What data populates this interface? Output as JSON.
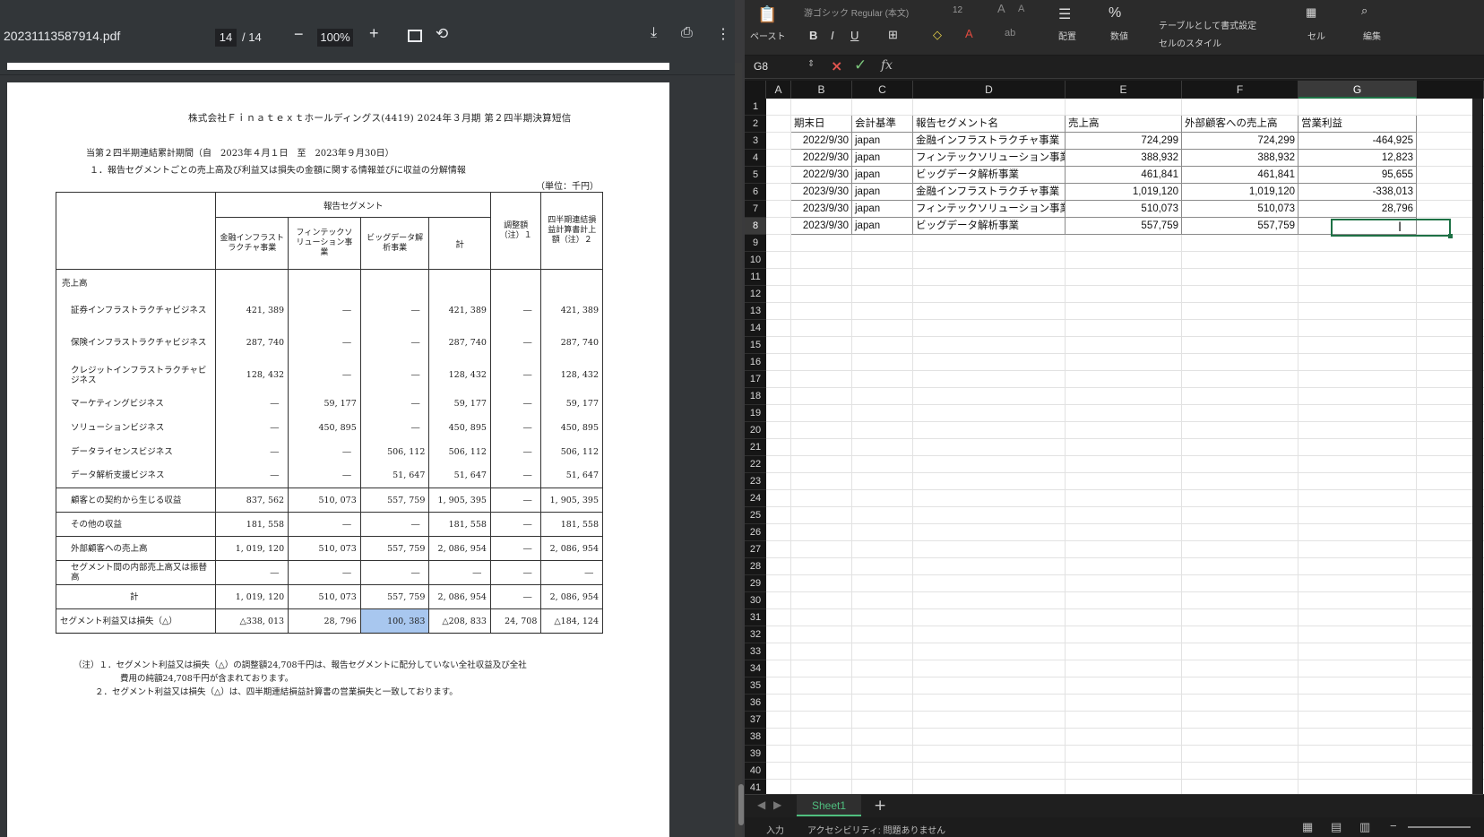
{
  "pdf": {
    "filename": "20231113587914.pdf",
    "page_current": "14",
    "page_total": "/ 14",
    "zoom": "100%",
    "header": "株式会社Ｆｉｎａｔｅｘｔホールディングス(4419) 2024年３月期 第２四半期決算短信",
    "period": "当第２四半期連結累計期間（自　2023年４月１日　至　2023年９月30日）",
    "section": "１．報告セグメントごとの売上高及び利益又は損失の金額に関する情報並びに収益の分解情報",
    "unit": "（単位：千円）",
    "table": {
      "group_header": "報告セグメント",
      "col_headers": [
        "金融インフラストラクチャ事業",
        "フィンテックソリューション事業",
        "ビッグデータ解析事業",
        "計",
        "調整額（注）１",
        "四半期連結損益計算書計上額（注）２"
      ],
      "revenue_label": "売上高",
      "rows": [
        {
          "label": "証券インフラストラクチャビジネス",
          "values": [
            "421, 389",
            "―",
            "―",
            "421, 389",
            "―",
            "421, 389"
          ]
        },
        {
          "label": "保険インフラストラクチャビジネス",
          "values": [
            "287, 740",
            "―",
            "―",
            "287, 740",
            "―",
            "287, 740"
          ]
        },
        {
          "label": "クレジットインフラストラクチャビジネス",
          "values": [
            "128, 432",
            "―",
            "―",
            "128, 432",
            "―",
            "128, 432"
          ]
        },
        {
          "label": "マーケティングビジネス",
          "values": [
            "―",
            "59, 177",
            "―",
            "59, 177",
            "―",
            "59, 177"
          ]
        },
        {
          "label": "ソリューションビジネス",
          "values": [
            "―",
            "450, 895",
            "―",
            "450, 895",
            "―",
            "450, 895"
          ]
        },
        {
          "label": "データライセンスビジネス",
          "values": [
            "―",
            "―",
            "506, 112",
            "506, 112",
            "―",
            "506, 112"
          ]
        },
        {
          "label": "データ解析支援ビジネス",
          "values": [
            "―",
            "―",
            "51, 647",
            "51, 647",
            "―",
            "51, 647"
          ]
        },
        {
          "label": "顧客との契約から生じる収益",
          "values": [
            "837, 562",
            "510, 073",
            "557, 759",
            "1, 905, 395",
            "―",
            "1, 905, 395"
          ]
        },
        {
          "label": "その他の収益",
          "values": [
            "181, 558",
            "―",
            "―",
            "181, 558",
            "―",
            "181, 558"
          ]
        },
        {
          "label": "外部顧客への売上高",
          "values": [
            "1, 019, 120",
            "510, 073",
            "557, 759",
            "2, 086, 954",
            "―",
            "2, 086, 954"
          ]
        },
        {
          "label": "セグメント間の内部売上高又は振替高",
          "values": [
            "―",
            "―",
            "―",
            "―",
            "―",
            "―"
          ]
        },
        {
          "label": "計",
          "values": [
            "1, 019, 120",
            "510, 073",
            "557, 759",
            "2, 086, 954",
            "―",
            "2, 086, 954"
          ]
        },
        {
          "label": "セグメント利益又は損失（△）",
          "values": [
            "△338, 013",
            "28, 796",
            "100, 383",
            "△208, 833",
            "24, 708",
            "△184, 124"
          ]
        }
      ]
    },
    "note1a": "（注）１．セグメント利益又は損失（△）の調整額24,708千円は、報告セグメントに配分していない全社収益及び全社",
    "note1b": "費用の純額24,708千円が含まれております。",
    "note2": "２．セグメント利益又は損失（△）は、四半期連結損益計算書の営業損失と一致しております。"
  },
  "excel": {
    "ribbon": {
      "paste": "ペースト",
      "font_name": "游ゴシック Regular (本文)",
      "font_size": "12",
      "bold": "B",
      "italic": "I",
      "underline": "U",
      "align": "配置",
      "number": "数値",
      "table_format": "テーブルとして書式設定",
      "cell_style": "セルのスタイル",
      "cells": "セル",
      "edit": "編集"
    },
    "namebox": "G8",
    "columns": [
      "A",
      "B",
      "C",
      "D",
      "E",
      "F",
      "G"
    ],
    "rows_visible": [
      "1",
      "2",
      "3",
      "4",
      "5",
      "6",
      "7",
      "8",
      "9",
      "10",
      "11",
      "12",
      "13",
      "14",
      "15",
      "16",
      "17",
      "18",
      "19",
      "20",
      "21",
      "22",
      "23",
      "24",
      "25",
      "26",
      "27",
      "28",
      "29",
      "30",
      "31",
      "32",
      "33",
      "34",
      "35",
      "36",
      "37",
      "38",
      "39",
      "40",
      "41"
    ],
    "headers": [
      "期末日",
      "会計基準",
      "報告セグメント名",
      "売上高",
      "外部顧客への売上高",
      "営業利益"
    ],
    "data": [
      [
        "2022/9/30",
        "japan",
        "金融インフラストラクチャ事業",
        "724,299",
        "724,299",
        "-464,925"
      ],
      [
        "2022/9/30",
        "japan",
        "フィンテックソリューション事業",
        "388,932",
        "388,932",
        "12,823"
      ],
      [
        "2022/9/30",
        "japan",
        "ビッグデータ解析事業",
        "461,841",
        "461,841",
        "95,655"
      ],
      [
        "2023/9/30",
        "japan",
        "金融インフラストラクチャ事業",
        "1,019,120",
        "1,019,120",
        "-338,013"
      ],
      [
        "2023/9/30",
        "japan",
        "フィンテックソリューション事業",
        "510,073",
        "510,073",
        "28,796"
      ],
      [
        "2023/9/30",
        "japan",
        "ビッグデータ解析事業",
        "557,759",
        "557,759",
        ""
      ]
    ],
    "sheet_tab": "Sheet1",
    "status_mode": "入力",
    "status_access": "アクセシビリティ: 問題ありません"
  }
}
